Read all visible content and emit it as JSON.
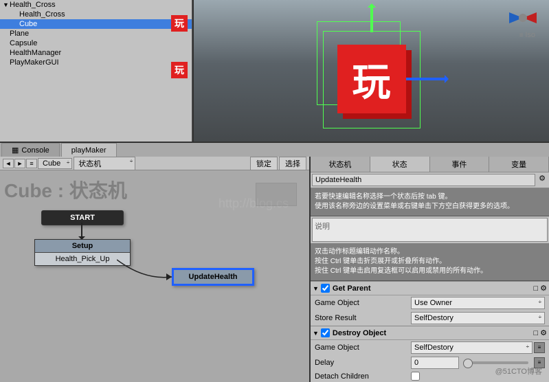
{
  "hierarchy": {
    "items": [
      {
        "label": "Health_Cross",
        "indent": 0,
        "tri": "▼"
      },
      {
        "label": "Health_Cross",
        "indent": 1,
        "tri": ""
      },
      {
        "label": "Cube",
        "indent": 1,
        "tri": "",
        "selected": true
      },
      {
        "label": "Plane",
        "indent": 0,
        "tri": ""
      },
      {
        "label": "Capsule",
        "indent": 0,
        "tri": ""
      },
      {
        "label": "HealthManager",
        "indent": 0,
        "tri": ""
      },
      {
        "label": "PlayMakerGUI",
        "indent": 0,
        "tri": ""
      }
    ],
    "badge_text": "玩"
  },
  "scene": {
    "iso": "Iso",
    "cube_text": "玩",
    "gizmo_x": "x",
    "gizmo_z": "z"
  },
  "tabs": {
    "console": "Console",
    "playmaker": "playMaker"
  },
  "fsm": {
    "toolbar": {
      "dd1": "Cube",
      "dd2": "状态机",
      "lock": "锁定",
      "select": "选择"
    },
    "title": "Cube : 状态机",
    "watermark": "http://blog.cs",
    "nodes": {
      "start": "START",
      "setup_hdr": "Setup",
      "setup_sub": "Health_Pick_Up",
      "update": "UpdateHealth"
    }
  },
  "inspector": {
    "tabs": [
      "状态机",
      "状态",
      "事件",
      "变量"
    ],
    "title_field": "UpdateHealth",
    "help1": "若要快速编辑名称选择一个状态后按 tab 键。\n使用该名称旁边的设置菜单或右键单击下方空白获得更多的选项。",
    "desc_placeholder": "说明",
    "help2": "双击动作标题编辑动作名称。\n按住 Ctrl 键单击折页展开或折叠所有动作。\n按住 Ctrl 键单击启用复选框可以启用或禁用的所有动作。",
    "actions": {
      "get_parent": {
        "title": "Get Parent",
        "rows": [
          {
            "label": "Game Object",
            "value": "Use Owner",
            "type": "dd"
          },
          {
            "label": "Store Result",
            "value": "SelfDestory",
            "type": "dd"
          }
        ]
      },
      "destroy_object": {
        "title": "Destroy Object",
        "rows": [
          {
            "label": "Game Object",
            "value": "SelfDestory",
            "type": "dd_eq"
          },
          {
            "label": "Delay",
            "value": "0",
            "type": "num_slider"
          },
          {
            "label": "Detach Children",
            "type": "checkbox"
          }
        ]
      }
    }
  },
  "footer": "@51CTO博客"
}
